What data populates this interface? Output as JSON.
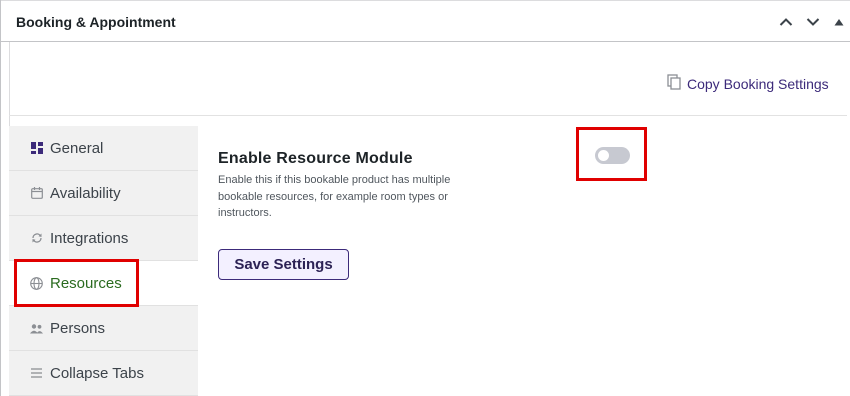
{
  "panel": {
    "title": "Booking & Appointment",
    "controls": {
      "move_up_icon": "chevron-up-icon",
      "move_down_icon": "chevron-down-icon",
      "toggle_panel_icon": "triangle-up-icon"
    }
  },
  "copy_link": {
    "icon": "copy-icon",
    "label": "Copy Booking Settings"
  },
  "tabs": [
    {
      "label": "General",
      "icon": "grid-icon",
      "active": false
    },
    {
      "label": "Availability",
      "icon": "calendar-icon",
      "active": false
    },
    {
      "label": "Integrations",
      "icon": "sync-icon",
      "active": false
    },
    {
      "label": "Resources",
      "icon": "globe-icon",
      "active": true
    },
    {
      "label": "Persons",
      "icon": "people-icon",
      "active": false
    },
    {
      "label": "Collapse Tabs",
      "icon": "menu-icon",
      "active": false
    }
  ],
  "setting": {
    "title": "Enable Resource Module",
    "description": "Enable this if this bookable product has multiple bookable resources, for example room types or instructors.",
    "toggle_enabled": false
  },
  "save_button": {
    "label": "Save Settings"
  },
  "colors": {
    "accent": "#3c2a7a",
    "highlight": "#e00000",
    "active_tab_text": "#2a6b1f",
    "toggle_off": "#c7c9d1"
  }
}
